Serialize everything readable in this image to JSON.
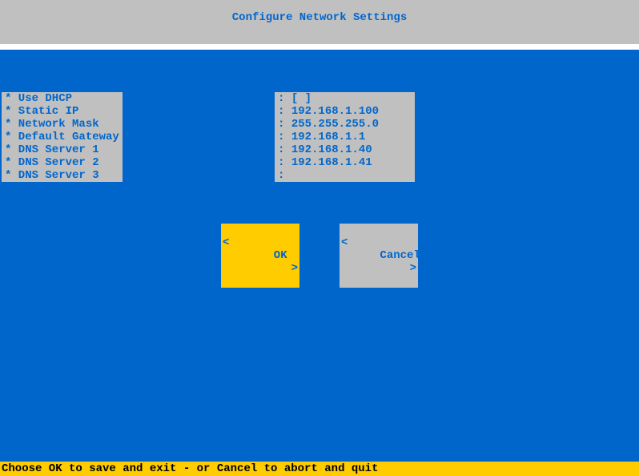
{
  "header": {
    "title": "Configure Network Settings"
  },
  "fields": {
    "use_dhcp": {
      "label": "* Use DHCP",
      "value": "[ ]"
    },
    "static_ip": {
      "label": "* Static IP",
      "value": "192.168.1.100"
    },
    "network_mask": {
      "label": "* Network Mask",
      "value": "255.255.255.0"
    },
    "default_gateway": {
      "label": "* Default Gateway",
      "value": "192.168.1.1"
    },
    "dns1": {
      "label": "* DNS Server 1",
      "value": "192.168.1.40"
    },
    "dns2": {
      "label": "* DNS Server 2",
      "value": "192.168.1.41"
    },
    "dns3": {
      "label": "* DNS Server 3",
      "value": ""
    }
  },
  "buttons": {
    "ok": "OK",
    "cancel": "Cancel"
  },
  "brackets": {
    "left": "<",
    "right": ">"
  },
  "footer": {
    "hint": "Choose OK to save and exit - or Cancel to abort and quit"
  },
  "colon": ": "
}
